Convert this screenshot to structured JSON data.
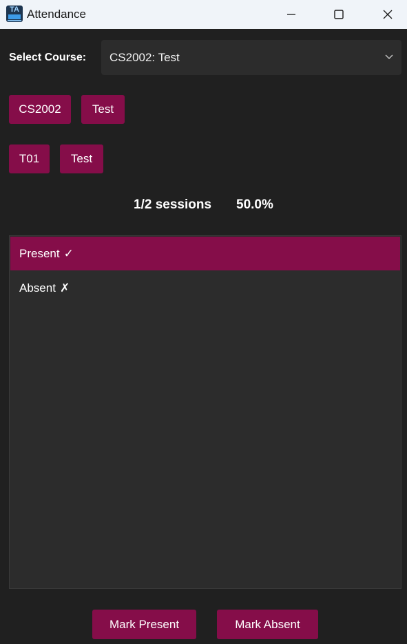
{
  "window": {
    "title": "Attendance",
    "icon_text": "TA"
  },
  "course": {
    "label": "Select Course:",
    "selected": "CS2002: Test"
  },
  "course_chips": [
    "CS2002",
    "Test"
  ],
  "tutorial_chips": [
    "T01",
    "Test"
  ],
  "stats": {
    "sessions": "1/2 sessions",
    "percentage": "50.0%"
  },
  "records": [
    {
      "status": "Present",
      "mark": "✓",
      "selected": true
    },
    {
      "status": "Absent",
      "mark": "✗",
      "selected": false
    }
  ],
  "actions": {
    "mark_present": "Mark Present",
    "mark_absent": "Mark Absent"
  },
  "colors": {
    "accent": "#850d49",
    "background": "#202020",
    "panel": "#2c2c2c",
    "titlebar": "#f0f4f9"
  }
}
